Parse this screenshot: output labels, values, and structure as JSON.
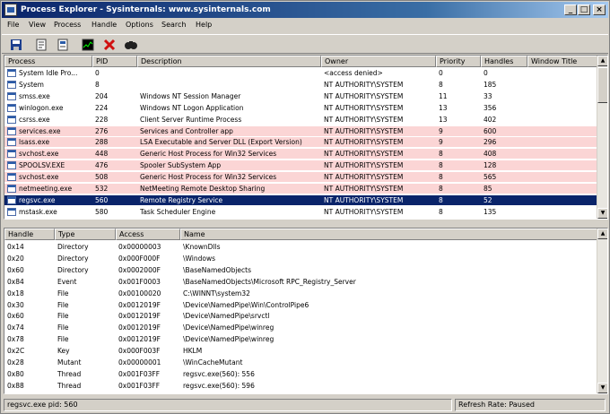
{
  "window": {
    "title": "Process Explorer - Sysinternals: www.sysinternals.com"
  },
  "caption_buttons": {
    "minimize": "_",
    "maximize": "□",
    "close": "×"
  },
  "menu": [
    "File",
    "View",
    "Process",
    "Handle",
    "Options",
    "Search",
    "Help"
  ],
  "toolbar": [
    "save-icon",
    "properties-icon",
    "document-icon",
    "cpu-graph-icon",
    "kill-process-icon",
    "find-icon"
  ],
  "process_columns": [
    "Process",
    "PID",
    "Description",
    "Owner",
    "Priority",
    "Handles",
    "Window Title"
  ],
  "processes": [
    {
      "name": "System Idle Pro...",
      "pid": "0",
      "desc": "",
      "owner": "<access denied>",
      "prio": "0",
      "handles": "0",
      "hl": ""
    },
    {
      "name": "System",
      "pid": "8",
      "desc": "",
      "owner": "NT AUTHORITY\\SYSTEM",
      "prio": "8",
      "handles": "185",
      "hl": ""
    },
    {
      "name": "smss.exe",
      "pid": "204",
      "desc": "Windows NT Session Manager",
      "owner": "NT AUTHORITY\\SYSTEM",
      "prio": "11",
      "handles": "33",
      "hl": ""
    },
    {
      "name": "winlogon.exe",
      "pid": "224",
      "desc": "Windows NT Logon Application",
      "owner": "NT AUTHORITY\\SYSTEM",
      "prio": "13",
      "handles": "356",
      "hl": ""
    },
    {
      "name": "csrss.exe",
      "pid": "228",
      "desc": "Client Server Runtime Process",
      "owner": "NT AUTHORITY\\SYSTEM",
      "prio": "13",
      "handles": "402",
      "hl": ""
    },
    {
      "name": "services.exe",
      "pid": "276",
      "desc": "Services and Controller app",
      "owner": "NT AUTHORITY\\SYSTEM",
      "prio": "9",
      "handles": "600",
      "hl": "pink"
    },
    {
      "name": "lsass.exe",
      "pid": "288",
      "desc": "LSA Executable and Server DLL (Export Version)",
      "owner": "NT AUTHORITY\\SYSTEM",
      "prio": "9",
      "handles": "296",
      "hl": "pink"
    },
    {
      "name": "svchost.exe",
      "pid": "448",
      "desc": "Generic Host Process for Win32 Services",
      "owner": "NT AUTHORITY\\SYSTEM",
      "prio": "8",
      "handles": "408",
      "hl": "pink"
    },
    {
      "name": "SPOOLSV.EXE",
      "pid": "476",
      "desc": "Spooler SubSystem App",
      "owner": "NT AUTHORITY\\SYSTEM",
      "prio": "8",
      "handles": "128",
      "hl": "pink"
    },
    {
      "name": "svchost.exe",
      "pid": "508",
      "desc": "Generic Host Process for Win32 Services",
      "owner": "NT AUTHORITY\\SYSTEM",
      "prio": "8",
      "handles": "565",
      "hl": "pink"
    },
    {
      "name": "netmeeting.exe",
      "pid": "532",
      "desc": "NetMeeting Remote Desktop Sharing",
      "owner": "NT AUTHORITY\\SYSTEM",
      "prio": "8",
      "handles": "85",
      "hl": "pink"
    },
    {
      "name": "regsvc.exe",
      "pid": "560",
      "desc": "Remote Registry Service",
      "owner": "NT AUTHORITY\\SYSTEM",
      "prio": "8",
      "handles": "52",
      "hl": "sel"
    },
    {
      "name": "mstask.exe",
      "pid": "580",
      "desc": "Task Scheduler Engine",
      "owner": "NT AUTHORITY\\SYSTEM",
      "prio": "8",
      "handles": "135",
      "hl": ""
    }
  ],
  "handle_columns": [
    "Handle",
    "Type",
    "Access",
    "Name"
  ],
  "handles": [
    {
      "handle": "0x14",
      "type": "Directory",
      "access": "0x00000003",
      "name": "\\KnownDlls"
    },
    {
      "handle": "0x20",
      "type": "Directory",
      "access": "0x000F000F",
      "name": "\\Windows"
    },
    {
      "handle": "0x60",
      "type": "Directory",
      "access": "0x0002000F",
      "name": "\\BaseNamedObjects"
    },
    {
      "handle": "0x84",
      "type": "Event",
      "access": "0x001F0003",
      "name": "\\BaseNamedObjects\\Microsoft RPC_Registry_Server"
    },
    {
      "handle": "0x18",
      "type": "File",
      "access": "0x00100020",
      "name": "C:\\WINNT\\system32"
    },
    {
      "handle": "0x30",
      "type": "File",
      "access": "0x0012019F",
      "name": "\\Device\\NamedPipe\\Win\\ControlPipe6"
    },
    {
      "handle": "0x60",
      "type": "File",
      "access": "0x0012019F",
      "name": "\\Device\\NamedPipe\\srvctl"
    },
    {
      "handle": "0x74",
      "type": "File",
      "access": "0x0012019F",
      "name": "\\Device\\NamedPipe\\winreg"
    },
    {
      "handle": "0x78",
      "type": "File",
      "access": "0x0012019F",
      "name": "\\Device\\NamedPipe\\winreg"
    },
    {
      "handle": "0x2C",
      "type": "Key",
      "access": "0x000F003F",
      "name": "HKLM"
    },
    {
      "handle": "0x28",
      "type": "Mutant",
      "access": "0x00000001",
      "name": "\\WinCacheMutant"
    },
    {
      "handle": "0x80",
      "type": "Thread",
      "access": "0x001F03FF",
      "name": "regsvc.exe(560): 556"
    },
    {
      "handle": "0x88",
      "type": "Thread",
      "access": "0x001F03FF",
      "name": "regsvc.exe(560): 596"
    }
  ],
  "status": {
    "left": "regsvc.exe pid: 560",
    "right": "Refresh Rate: Paused"
  },
  "colors": {
    "title_start": "#0a246a",
    "title_end": "#a6caf0",
    "service_highlight": "#fbd5d5",
    "selection": "#0a246a"
  }
}
